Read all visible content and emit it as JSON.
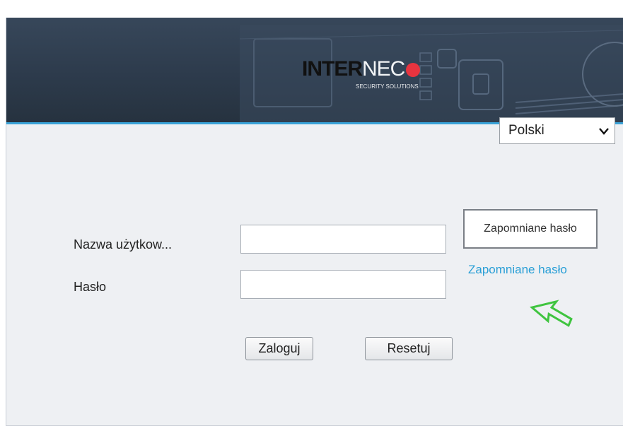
{
  "header": {
    "logo_bold": "INTER",
    "logo_light": "NEC",
    "logo_tagline": "SECURITY SOLUTIONS"
  },
  "language": {
    "selected": "Polski",
    "chevron_icon": "chevron-down-icon"
  },
  "form": {
    "username_label": "Nazwa użytkow...",
    "username_value": "",
    "password_label": "Hasło",
    "password_value": "",
    "tooltip_text": "Zapomniane hasło",
    "forgot_link": "Zapomniane hasło",
    "login_button": "Zaloguj",
    "reset_button": "Resetuj"
  },
  "annotation": {
    "arrow_icon": "pointer-arrow-icon",
    "arrow_color": "#3fc43f"
  },
  "colors": {
    "header_bg": "#2f3d4e",
    "accent_line": "#3aa3d8",
    "link": "#2a9fd6",
    "logo_mark": "#e8343f"
  }
}
